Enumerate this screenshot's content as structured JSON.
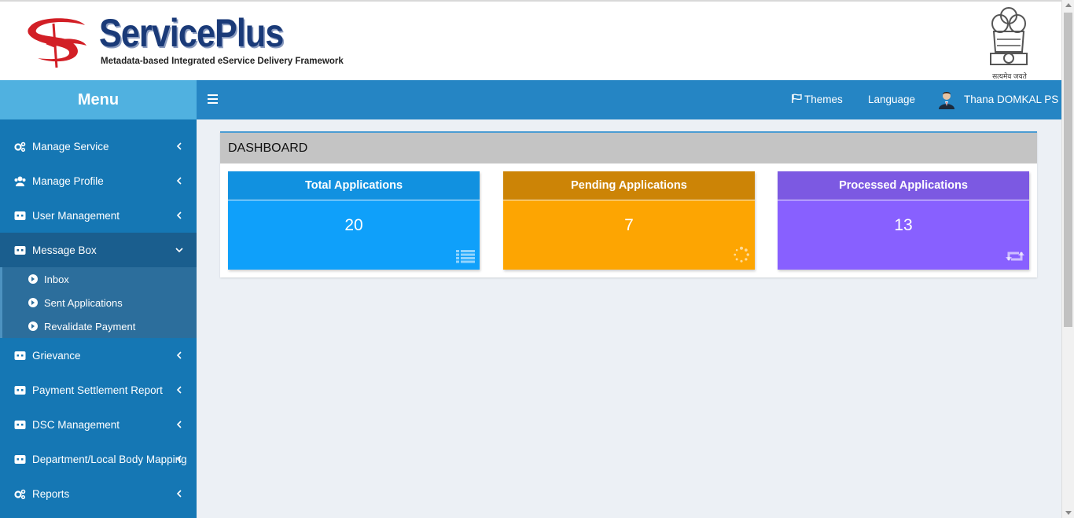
{
  "header": {
    "brand_name": "ServicePlus",
    "brand_tagline": "Metadata-based Integrated eService Delivery Framework",
    "emblem_caption": "सत्यमेव जयते"
  },
  "menu_title": "Menu",
  "navbar": {
    "menu_toggle_icon": "hamburger-icon",
    "themes_label": "Themes",
    "language_label": "Language",
    "user_name": "Thana DOMKAL PS"
  },
  "sidebar": {
    "items": [
      {
        "label": "Manage Service",
        "icon": "cogs-icon",
        "expanded": false
      },
      {
        "label": "Manage Profile",
        "icon": "users-icon",
        "expanded": false
      },
      {
        "label": "User Management",
        "icon": "id-card-icon",
        "expanded": false
      },
      {
        "label": "Message Box",
        "icon": "id-card-icon",
        "expanded": true
      },
      {
        "label": "Grievance",
        "icon": "id-card-icon",
        "expanded": false
      },
      {
        "label": "Payment Settlement Report",
        "icon": "id-card-icon",
        "expanded": false
      },
      {
        "label": "DSC Management",
        "icon": "id-card-icon",
        "expanded": false
      },
      {
        "label": "Department/Local Body Mapping",
        "icon": "id-card-icon",
        "expanded": false
      },
      {
        "label": "Reports",
        "icon": "cogs-icon",
        "expanded": false
      }
    ],
    "message_box_submenu": [
      {
        "label": "Inbox"
      },
      {
        "label": "Sent Applications"
      },
      {
        "label": "Revalidate Payment"
      }
    ]
  },
  "dashboard": {
    "title": "DASHBOARD",
    "cards": [
      {
        "title": "Total Applications",
        "value": "20",
        "icon": "list-icon",
        "color": "#0fa0fa"
      },
      {
        "title": "Pending Applications",
        "value": "7",
        "icon": "spinner-icon",
        "color": "#fda502"
      },
      {
        "title": "Processed Applications",
        "value": "13",
        "icon": "retweet-icon",
        "color": "#8860ff"
      }
    ]
  }
}
